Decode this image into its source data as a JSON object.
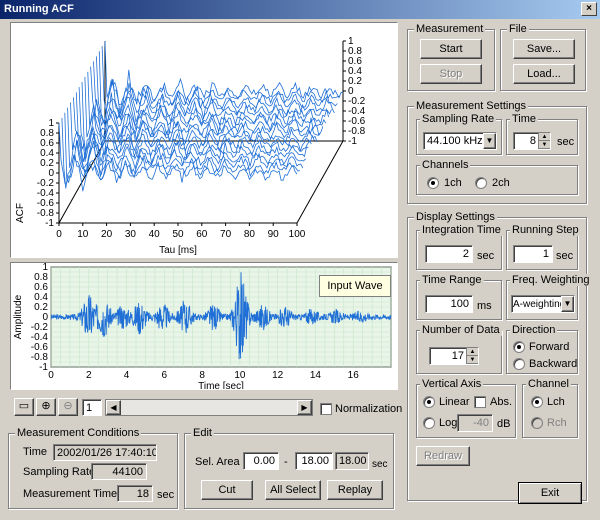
{
  "window": {
    "title": "Running ACF",
    "close_label": "×"
  },
  "acf_plot": {
    "y_label": "ACF",
    "x_label": "Tau [ms]",
    "x_ticks": [
      "0",
      "10",
      "20",
      "30",
      "40",
      "50",
      "60",
      "70",
      "80",
      "90",
      "100"
    ],
    "left_ticks": [
      "1",
      "0.8",
      "0.6",
      "0.4",
      "0.2",
      "0",
      "-0.2",
      "-0.4",
      "-0.6",
      "-0.8",
      "-1"
    ],
    "right_ticks": [
      "1",
      "0.8",
      "0.6",
      "0.4",
      "0.2",
      "0",
      "-0.2",
      "-0.4",
      "-0.6",
      "-0.8",
      "-1"
    ]
  },
  "wave_plot": {
    "y_label": "Amplitude",
    "x_label": "Time [sec]",
    "badge": "Input Wave",
    "x_ticks": [
      "0",
      "2",
      "4",
      "6",
      "8",
      "10",
      "12",
      "14",
      "16"
    ],
    "y_ticks": [
      "1",
      "0.8",
      "0.6",
      "0.4",
      "0.2",
      "0",
      "-0.2",
      "-0.4",
      "-0.6",
      "-0.8",
      "-1"
    ],
    "bursts": [
      {
        "t": 2.0,
        "a": 0.45
      },
      {
        "t": 2.8,
        "a": 0.35
      },
      {
        "t": 3.8,
        "a": 0.2
      },
      {
        "t": 4.7,
        "a": 0.3
      },
      {
        "t": 5.9,
        "a": 0.25
      },
      {
        "t": 7.1,
        "a": 0.3
      },
      {
        "t": 8.6,
        "a": 0.22
      },
      {
        "t": 10.05,
        "a": 0.85
      },
      {
        "t": 11.2,
        "a": 0.22
      },
      {
        "t": 12.4,
        "a": 0.18
      },
      {
        "t": 13.8,
        "a": 0.12
      },
      {
        "t": 15.1,
        "a": 0.1
      },
      {
        "t": 16.4,
        "a": 0.08
      }
    ]
  },
  "toolbar": {
    "page_number": "1",
    "normalization_label": "Normalization"
  },
  "measurement": {
    "title": "Measurement",
    "start": "Start",
    "stop": "Stop"
  },
  "file": {
    "title": "File",
    "save": "Save...",
    "load": "Load..."
  },
  "settings": {
    "title": "Measurement Settings",
    "sampling_rate_label": "Sampling Rate",
    "sampling_rate_value": "44.100 kHz",
    "time_label": "Time",
    "time_value": "8",
    "time_unit": "sec",
    "channels_label": "Channels",
    "ch1": "1ch",
    "ch2": "2ch"
  },
  "display": {
    "title": "Display Settings",
    "integration_label": "Integration Time",
    "integration_value": "2",
    "integration_unit": "sec",
    "running_step_label": "Running Step",
    "running_step_value": "1",
    "running_step_unit": "sec",
    "time_range_label": "Time Range",
    "time_range_value": "100",
    "time_range_unit": "ms",
    "freq_weighting_label": "Freq. Weighting",
    "freq_weighting_value": "A-weighting",
    "num_data_label": "Number of Data",
    "num_data_value": "17",
    "direction_label": "Direction",
    "forward": "Forward",
    "backward": "Backward",
    "vertical_axis_label": "Vertical Axis",
    "linear": "Linear",
    "abs": "Abs.",
    "log": "Log",
    "log_value": "-40",
    "log_unit": "dB",
    "channel_label": "Channel",
    "lch": "Lch",
    "rch": "Rch",
    "redraw": "Redraw"
  },
  "conditions": {
    "title": "Measurement Conditions",
    "time_label": "Time",
    "time_value": "2002/01/26 17:40:10",
    "sampling_label": "Sampling Rate",
    "sampling_value": "44100",
    "mtime_label": "Measurement Time",
    "mtime_value": "18",
    "mtime_unit": "sec"
  },
  "edit": {
    "title": "Edit",
    "sel_area_label": "Sel. Area",
    "from": "0.00",
    "dash": "-",
    "to": "18.00",
    "length": "18.00",
    "unit": "sec",
    "cut": "Cut",
    "all_select": "All Select",
    "replay": "Replay"
  },
  "exit": "Exit",
  "colors": {
    "trace": "#1f6fd6",
    "title_start": "#0a246a",
    "title_end": "#a6caf0",
    "grid": "#c8e6c8"
  }
}
